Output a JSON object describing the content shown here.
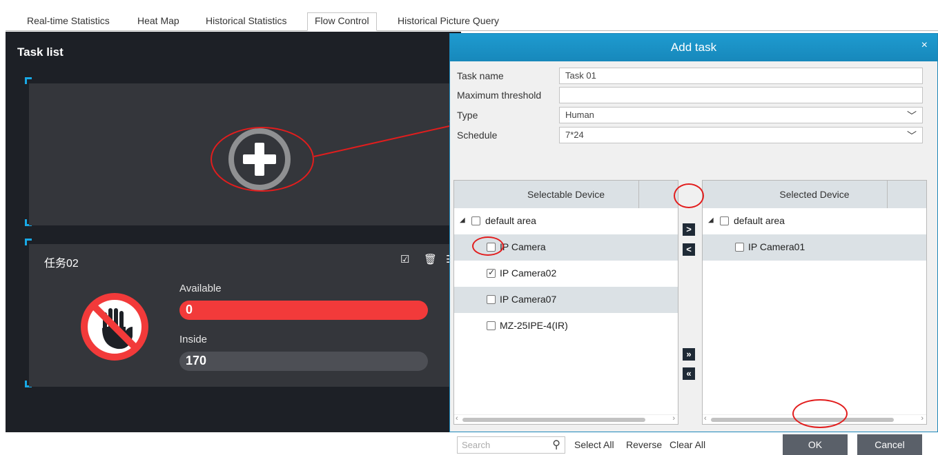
{
  "tabs": [
    "Real-time Statistics",
    "Heat Map",
    "Historical Statistics",
    "Flow Control",
    "Historical Picture Query"
  ],
  "left": {
    "title": "Task list",
    "task2": {
      "name": "任务02",
      "available_label": "Available",
      "available_value": "0",
      "inside_label": "Inside",
      "inside_value": "170"
    }
  },
  "dialog": {
    "title": "Add task",
    "close": "×",
    "task_name_label": "Task name",
    "task_name_value": "Task 01",
    "max_threshold_label": "Maximum threshold",
    "max_threshold_value": "",
    "type_label": "Type",
    "type_value": "Human",
    "schedule_label": "Schedule",
    "schedule_value": "7*24",
    "selectable_header": "Selectable Device",
    "selected_header": "Selected Device",
    "selectable": [
      {
        "label": "default area",
        "checked": false
      },
      {
        "label": "IP Camera",
        "checked": false
      },
      {
        "label": "IP Camera02",
        "checked": true
      },
      {
        "label": "IP Camera07",
        "checked": false
      },
      {
        "label": "MZ-25IPE-4(IR)",
        "checked": false
      }
    ],
    "selected": [
      {
        "label": "default area",
        "checked": false
      },
      {
        "label": "IP Camera01",
        "checked": false
      }
    ],
    "move": {
      "right": ">",
      "left": "<",
      "all_right": "»",
      "all_left": "«"
    },
    "search_placeholder": "Search",
    "select_all": "Select All",
    "reverse": "Reverse",
    "clear_all": "Clear All",
    "ok": "OK",
    "cancel": "Cancel"
  },
  "colors": {
    "accent": "#1e9bd0",
    "panel": "#1d2026",
    "card": "#34363b",
    "available_bar": "#f23a3a",
    "annotation": "#e21d1d"
  }
}
